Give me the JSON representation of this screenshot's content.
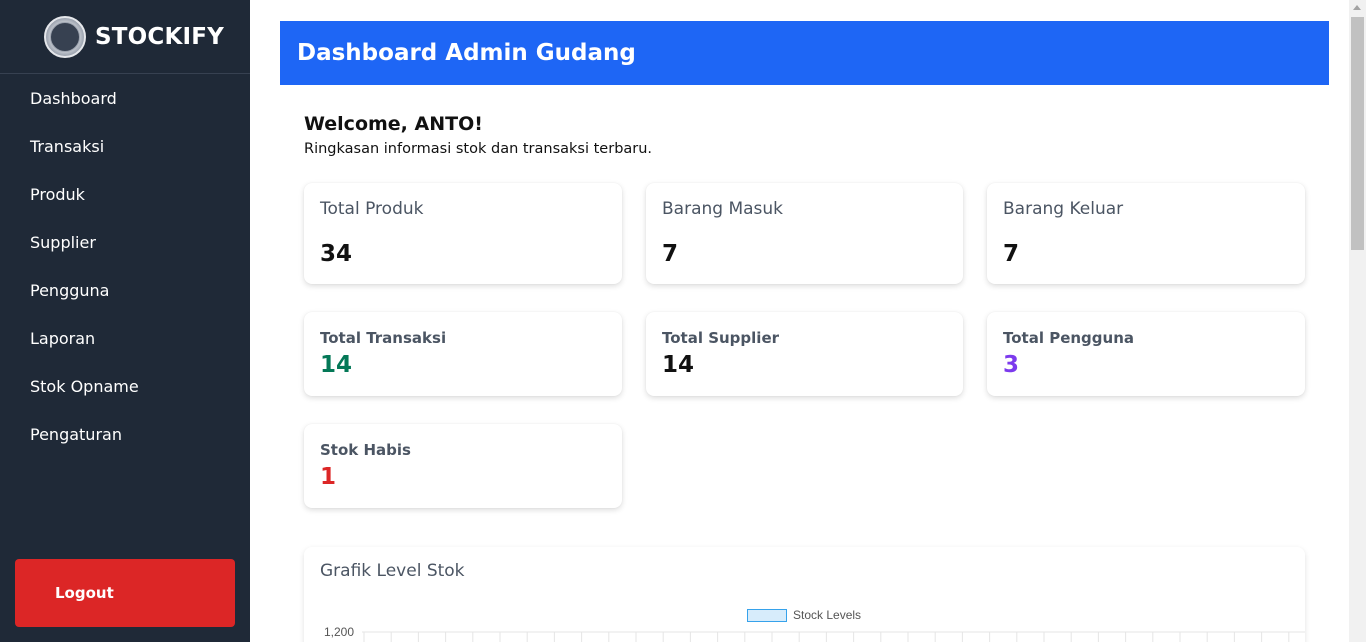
{
  "brand": {
    "name": "STOCKIFY",
    "logo_text": "STOCKIFY"
  },
  "sidebar": {
    "items": [
      {
        "label": "Dashboard"
      },
      {
        "label": "Transaksi"
      },
      {
        "label": "Produk"
      },
      {
        "label": "Supplier"
      },
      {
        "label": "Pengguna"
      },
      {
        "label": "Laporan"
      },
      {
        "label": "Stok Opname"
      },
      {
        "label": "Pengaturan"
      }
    ],
    "logout_label": "Logout"
  },
  "header": {
    "title": "Dashboard Admin Gudang"
  },
  "welcome": {
    "title": "Welcome, ANTO!",
    "subtitle": "Ringkasan informasi stok dan transaksi terbaru."
  },
  "stats_primary": [
    {
      "label": "Total Produk",
      "value": "34"
    },
    {
      "label": "Barang Masuk",
      "value": "7"
    },
    {
      "label": "Barang Keluar",
      "value": "7"
    }
  ],
  "stats_secondary": [
    {
      "label": "Total Transaksi",
      "value": "14",
      "color": "#047857"
    },
    {
      "label": "Total Supplier",
      "value": "14",
      "color": "#111111"
    },
    {
      "label": "Total Pengguna",
      "value": "3",
      "color": "#7c3aed"
    },
    {
      "label": "Stok Habis",
      "value": "1",
      "color": "#dc2626"
    }
  ],
  "colors": {
    "sidebar_bg": "#1f2937",
    "header_bg": "#1e66f5",
    "logout_bg": "#dc2626",
    "chart_fill": "rgba(54,162,235,0.2)",
    "chart_border": "#36a2eb"
  },
  "chart_data": {
    "type": "bar",
    "title": "Grafik Level Stok",
    "legend": [
      "Stock Levels"
    ],
    "series": [
      {
        "name": "Stock Levels",
        "values": []
      }
    ],
    "y_tick_labels": [
      "1,200"
    ],
    "ylim": [
      0,
      1200
    ],
    "legend_position": "top"
  }
}
